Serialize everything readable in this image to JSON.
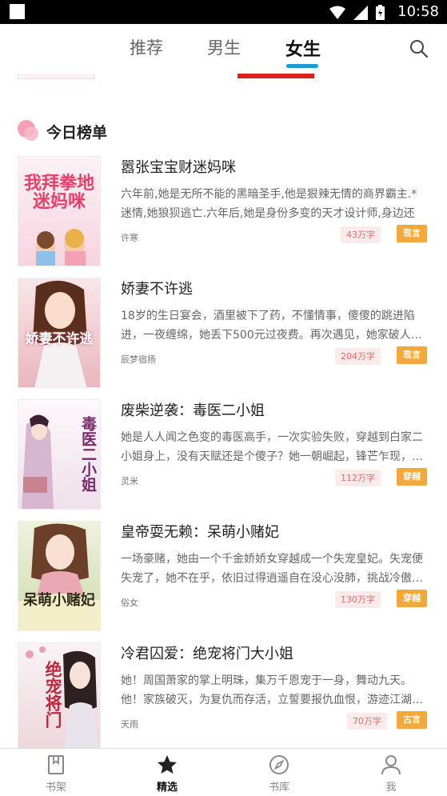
{
  "status_bar": {
    "time": "10:58"
  },
  "tabs": [
    {
      "label": "推荐",
      "active": false
    },
    {
      "label": "男生",
      "active": false
    },
    {
      "label": "女生",
      "active": true
    }
  ],
  "accent_color": "#1e9bd7",
  "section": {
    "title": "今日榜单"
  },
  "books": [
    {
      "title": "嚣张宝宝财迷妈咪",
      "desc": "六年前,她是无所不能的黑暗圣手,他是狠辣无情的商界霸主.*迷情,她狼狈逃亡.六年后,她是身份多变的天才设计师,身边还带…",
      "author": "许寒",
      "count": "43万字",
      "category": "现言",
      "cover_text": "我拜拳地迷妈咪",
      "cover_colors": [
        "#fbe7ef",
        "#f7d3e0"
      ]
    },
    {
      "title": "娇妻不许逃",
      "desc": "18岁的生日宴会，酒里被下了药，不懂情事，傻傻的跳进陷进，一夜缠绵，她丢下500元过夜费。再次遇见，她家破人…",
      "author": "辰梦宿扬",
      "count": "204万字",
      "category": "现言",
      "cover_text": "娇妻不许逃",
      "cover_colors": [
        "#f6e0e3",
        "#eab7bd"
      ]
    },
    {
      "title": "废柴逆袭：毒医二小姐",
      "desc": "她是人人闻之色变的毒医高手，一次实验失败，穿越到白家二小姐身上，没有天赋还是个傻子？她一朝崛起，锋芒乍现，…",
      "author": "灵米",
      "count": "112万字",
      "category": "穿越",
      "cover_text": "毒医二小姐",
      "cover_colors": [
        "#fbf5f8",
        "#efe0ea"
      ]
    },
    {
      "title": "皇帝耍无赖：呆萌小赌妃",
      "desc": "一场豪赌，她由一个千金娇娇女穿越成一个失宠皇妃。失宠便失宠了，她不在乎，依旧过得逍遥自在没心没肺，挑战冷傲…",
      "author": "俗女",
      "count": "130万字",
      "category": "穿越",
      "cover_text": "呆萌小赌妃",
      "cover_colors": [
        "#e8edd2",
        "#cfdab0"
      ]
    },
    {
      "title": "冷君囚爱：绝宠将门大小姐",
      "desc": "她！周国萧家的掌上明珠，集万千恩宠于一身，舞动九天。他！家族破灭，为复仇而存活，立誓要报仇血恨，游迹江湖…",
      "author": "天雨",
      "count": "70万字",
      "category": "古言",
      "cover_text": "绝宠将门",
      "cover_colors": [
        "#f7eef0",
        "#ecd6dc"
      ]
    }
  ],
  "bottom_nav": [
    {
      "label": "书架",
      "icon": "bookshelf-icon",
      "active": false
    },
    {
      "label": "精选",
      "icon": "star-icon",
      "active": true
    },
    {
      "label": "书库",
      "icon": "compass-icon",
      "active": false
    },
    {
      "label": "我",
      "icon": "profile-icon",
      "active": false
    }
  ]
}
